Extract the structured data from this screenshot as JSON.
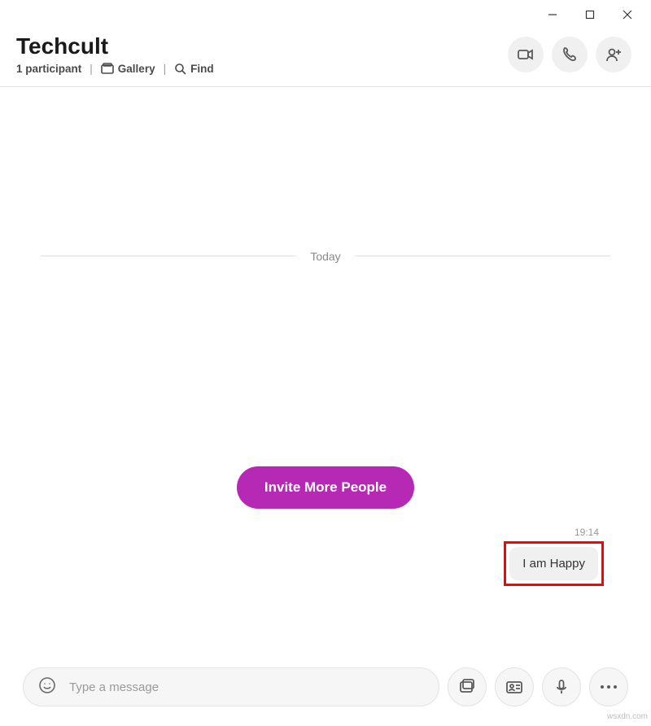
{
  "window_controls": {
    "min": "minimize",
    "max": "maximize",
    "close": "close"
  },
  "header": {
    "title": "Techcult",
    "participants": "1 participant",
    "gallery": "Gallery",
    "find": "Find"
  },
  "actions": {
    "video": "video-call",
    "audio": "audio-call",
    "add": "add-participant"
  },
  "conversation": {
    "date_divider": "Today",
    "invite_label": "Invite More People",
    "message_time": "19:14",
    "message_text": "I am Happy"
  },
  "composer": {
    "placeholder": "Type a message",
    "emoji": "emoji",
    "media": "media-gallery",
    "contact": "share-contact",
    "voice": "voice-message",
    "more": "more-options"
  },
  "watermark": "wsxdn.com"
}
